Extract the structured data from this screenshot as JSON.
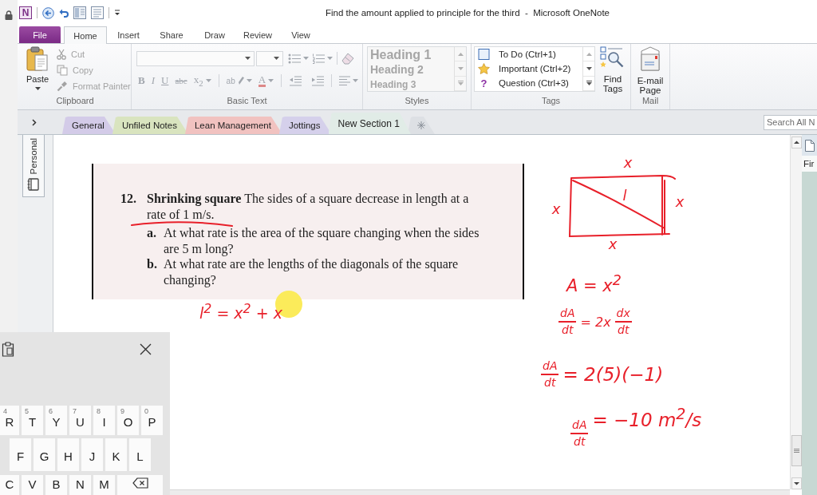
{
  "window": {
    "logo_text": "N",
    "title": "Find the amount applied to principle for the third  -  Microsoft OneNote"
  },
  "ribbon": {
    "tabs": [
      {
        "label": "File",
        "kind": "file",
        "selected": false
      },
      {
        "label": "Home",
        "kind": "tab",
        "selected": true
      },
      {
        "label": "Insert",
        "kind": "tab",
        "selected": false
      },
      {
        "label": "Share",
        "kind": "tab",
        "selected": false
      },
      {
        "label": "Draw",
        "kind": "tab",
        "selected": false
      },
      {
        "label": "Review",
        "kind": "tab",
        "selected": false
      },
      {
        "label": "View",
        "kind": "tab",
        "selected": false
      }
    ],
    "clipboard": {
      "label": "Clipboard",
      "paste": "Paste",
      "commands": [
        {
          "label": "Cut",
          "kind": "cut",
          "disabled": true
        },
        {
          "label": "Copy",
          "kind": "copy",
          "disabled": true
        },
        {
          "label": "Format Painter",
          "kind": "painter",
          "disabled": true
        }
      ]
    },
    "basic_text": {
      "label": "Basic Text",
      "disabled": true,
      "format_buttons": [
        {
          "kind": "bold",
          "label": "B"
        },
        {
          "kind": "italic",
          "label": "I"
        },
        {
          "kind": "underline",
          "label": "U"
        },
        {
          "kind": "strike",
          "label": "abc"
        },
        {
          "kind": "subscript",
          "label": "x$_{2}$"
        },
        {
          "kind": "highlight",
          "label": "ab"
        },
        {
          "kind": "font_color",
          "label": "A"
        }
      ]
    },
    "styles": {
      "label": "Styles",
      "disabled": true,
      "items": [
        {
          "label": "Heading 1",
          "kind": "h1"
        },
        {
          "label": "Heading 2",
          "kind": "h2"
        },
        {
          "label": "Heading 3",
          "kind": "h3"
        }
      ]
    },
    "tags": {
      "label": "Tags",
      "items": [
        {
          "label": "To Do (Ctrl+1)",
          "kind": "todo"
        },
        {
          "label": "Important (Ctrl+2)",
          "kind": "important"
        },
        {
          "label": "Question (Ctrl+3)",
          "kind": "question",
          "symbol": "?"
        }
      ],
      "find_button": "Find Tags"
    },
    "mail": {
      "label": "Mail",
      "button": "E-mail Page"
    }
  },
  "section_tabs": [
    {
      "label": "General",
      "color": "#d3cbe8",
      "selected": false
    },
    {
      "label": "Unfiled Notes",
      "color": "#d9e4bf",
      "selected": false
    },
    {
      "label": "Lean Management",
      "color": "#f1c2c0",
      "selected": false
    },
    {
      "label": "Jottings",
      "color": "#d5d0eb",
      "selected": false
    },
    {
      "label": "New Section 1",
      "color": "#e1ece7",
      "selected": true
    }
  ],
  "search": {
    "placeholder": "Search All N"
  },
  "notebook": {
    "name": "Personal"
  },
  "page": {
    "problem": {
      "number": "12.",
      "text": "**Shrinking square** The sides of a square decrease in length at a rate of 1 m/s.",
      "parts": [
        {
          "label": "a.",
          "text": "At what rate is the area of the square changing when the sides are 5 m long?"
        },
        {
          "label": "b.",
          "text": "At what rate are the lengths of the diagonals of the square changing?"
        }
      ]
    },
    "ink": {
      "working": "l$^{2}$ = x$^{2}$ + x",
      "diagram": {
        "side_labels": [
          "x",
          "x",
          "x",
          "x"
        ],
        "diagonal_label": "l"
      },
      "equations": [
        {
          "parts": [
            {
              "kind": "text",
              "text": "A = x$^{2}$"
            }
          ]
        },
        {
          "parts": [
            {
              "kind": "frac",
              "num": "dA",
              "den": "dt"
            },
            {
              "kind": "text",
              "text": "= 2x"
            },
            {
              "kind": "frac",
              "num": "dx",
              "den": "dt"
            }
          ]
        },
        {
          "parts": [
            {
              "kind": "frac",
              "num": "dA",
              "den": "dt"
            },
            {
              "kind": "text",
              "text": "= 2(5)(−1)"
            }
          ]
        },
        {
          "parts": [
            {
              "kind": "frac",
              "num": "dA",
              "den": "dt"
            },
            {
              "kind": "text",
              "text": "= −10 m$^{2}$/s"
            }
          ]
        }
      ]
    }
  },
  "page_list": [
    {
      "title": "Fir"
    }
  ],
  "keyboard": {
    "rows": [
      [
        {
          "kind": "letter",
          "label": "R",
          "hint": "4"
        },
        {
          "kind": "letter",
          "label": "T",
          "hint": "5"
        },
        {
          "kind": "letter",
          "label": "Y",
          "hint": "6"
        },
        {
          "kind": "letter",
          "label": "U",
          "hint": "7"
        },
        {
          "kind": "letter",
          "label": "I",
          "hint": "8"
        },
        {
          "kind": "letter",
          "label": "O",
          "hint": "9"
        },
        {
          "kind": "letter",
          "label": "P",
          "hint": "0"
        }
      ],
      [
        {
          "kind": "letter",
          "label": "F"
        },
        {
          "kind": "letter",
          "label": "G"
        },
        {
          "kind": "letter",
          "label": "H"
        },
        {
          "kind": "letter",
          "label": "J"
        },
        {
          "kind": "letter",
          "label": "K"
        },
        {
          "kind": "letter",
          "label": "L"
        }
      ],
      [
        {
          "kind": "letter",
          "label": "C"
        },
        {
          "kind": "letter",
          "label": "V"
        },
        {
          "kind": "letter",
          "label": "B"
        },
        {
          "kind": "letter",
          "label": "N"
        },
        {
          "kind": "letter",
          "label": "M"
        },
        {
          "kind": "backspace"
        }
      ]
    ]
  }
}
